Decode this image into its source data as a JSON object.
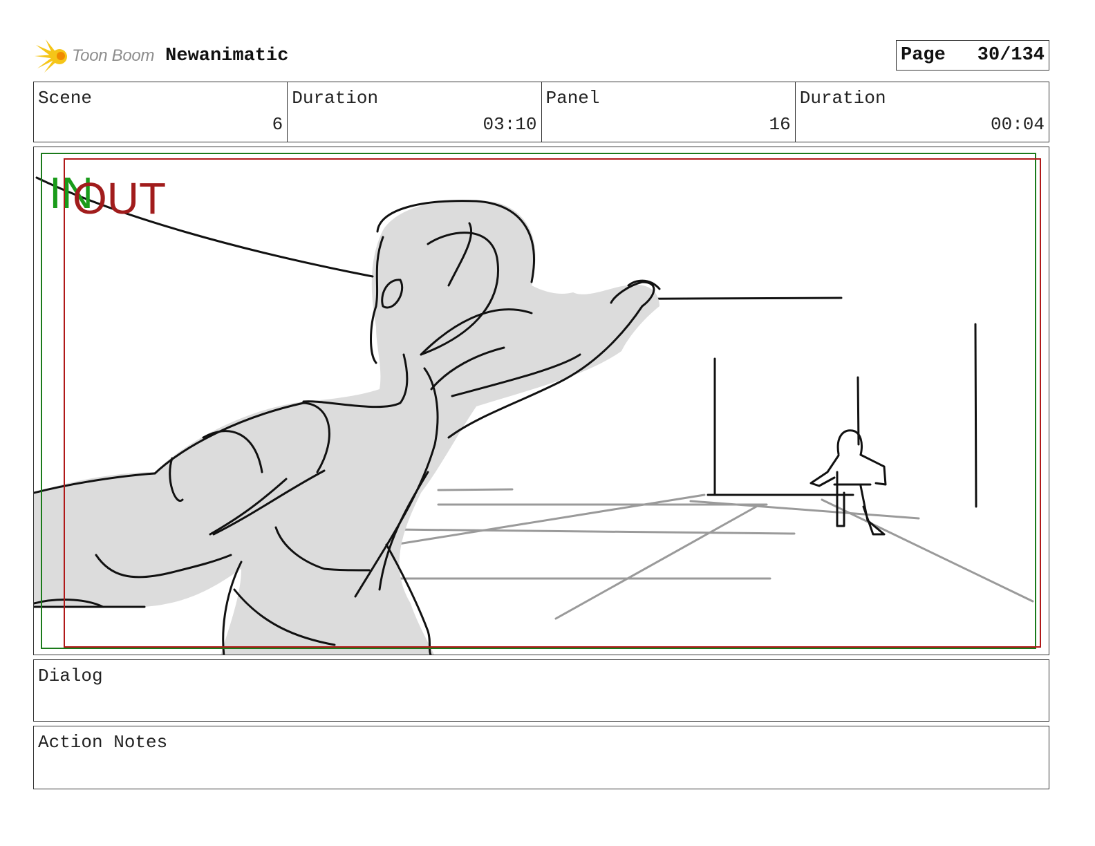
{
  "header": {
    "logo_text": "Toon Boom",
    "project_title": "Newanimatic"
  },
  "page": {
    "label": "Page",
    "number": "30/134"
  },
  "info": {
    "scene_label": "Scene",
    "scene_value": "6",
    "scene_duration_label": "Duration",
    "scene_duration_value": "03:10",
    "panel_label": "Panel",
    "panel_value": "16",
    "panel_duration_label": "Duration",
    "panel_duration_value": "00:04"
  },
  "frame": {
    "in_label": "IN",
    "out_label": "OUT",
    "in_color": "#1a9b1a",
    "out_color": "#a11c1c"
  },
  "dialog": {
    "label": "Dialog"
  },
  "action_notes": {
    "label": "Action Notes"
  }
}
